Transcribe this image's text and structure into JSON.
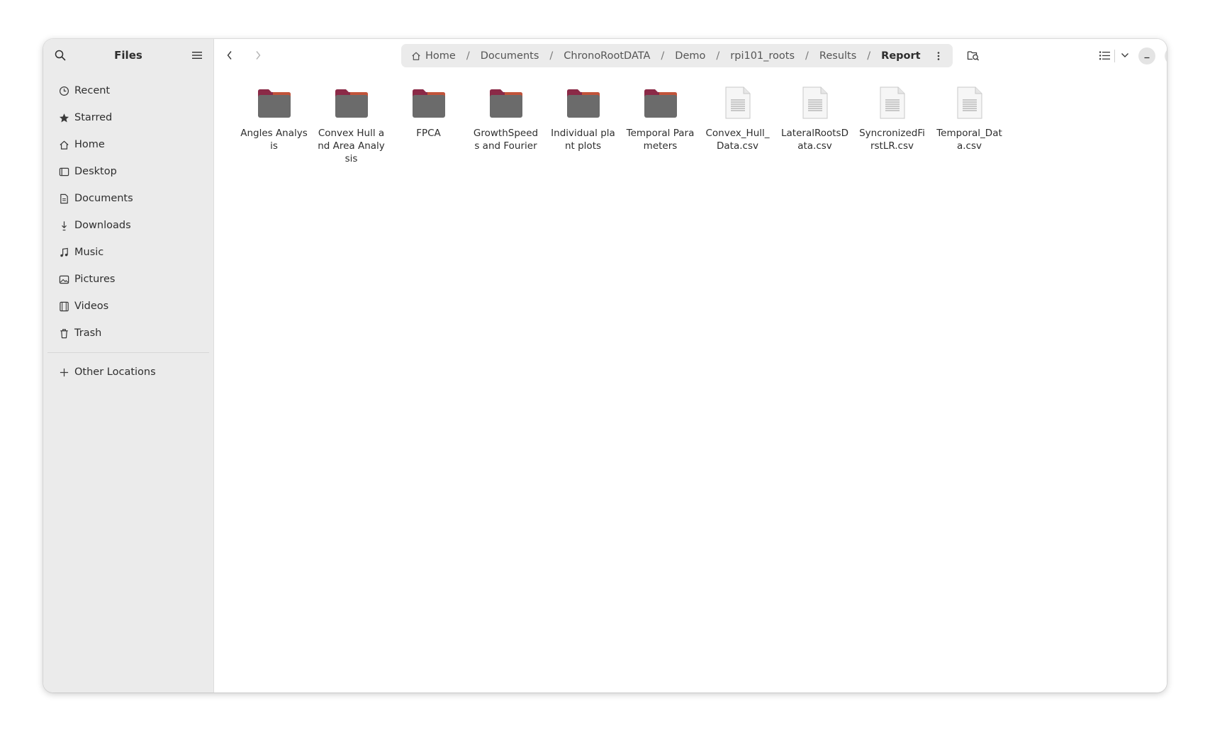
{
  "sidebar": {
    "title": "Files",
    "search_icon": "search-icon",
    "menu_icon": "hamburger-menu-icon",
    "items": [
      {
        "label": "Recent",
        "icon": "clock-icon"
      },
      {
        "label": "Starred",
        "icon": "star-icon"
      },
      {
        "label": "Home",
        "icon": "home-icon"
      },
      {
        "label": "Desktop",
        "icon": "desktop-icon"
      },
      {
        "label": "Documents",
        "icon": "document-icon"
      },
      {
        "label": "Downloads",
        "icon": "download-icon"
      },
      {
        "label": "Music",
        "icon": "music-note-icon"
      },
      {
        "label": "Pictures",
        "icon": "picture-icon"
      },
      {
        "label": "Videos",
        "icon": "film-icon"
      },
      {
        "label": "Trash",
        "icon": "trash-icon"
      }
    ],
    "other_locations": {
      "label": "Other Locations",
      "icon": "plus-icon"
    }
  },
  "pathbar": {
    "crumbs": [
      "Home",
      "Documents",
      "ChronoRootDATA",
      "Demo",
      "rpi101_roots",
      "Results",
      "Report"
    ],
    "separator": "/"
  },
  "files": [
    {
      "name": "Angles Analysis",
      "type": "folder"
    },
    {
      "name": "Convex Hull and Area Analysis",
      "type": "folder"
    },
    {
      "name": "FPCA",
      "type": "folder"
    },
    {
      "name": "GrowthSpeeds and Fourier",
      "type": "folder"
    },
    {
      "name": "Individual plant plots",
      "type": "folder"
    },
    {
      "name": "Temporal Parameters",
      "type": "folder"
    },
    {
      "name": "Convex_Hull_Data.csv",
      "type": "file"
    },
    {
      "name": "LateralRootsData.csv",
      "type": "file"
    },
    {
      "name": "SyncronizedFirstLR.csv",
      "type": "file"
    },
    {
      "name": "Temporal_Data.csv",
      "type": "file"
    }
  ],
  "colors": {
    "folder_top": "#8b2a47",
    "folder_accent": "#c2543a",
    "folder_body": "#6b6b6b",
    "sidebar_bg": "#ebebeb"
  }
}
